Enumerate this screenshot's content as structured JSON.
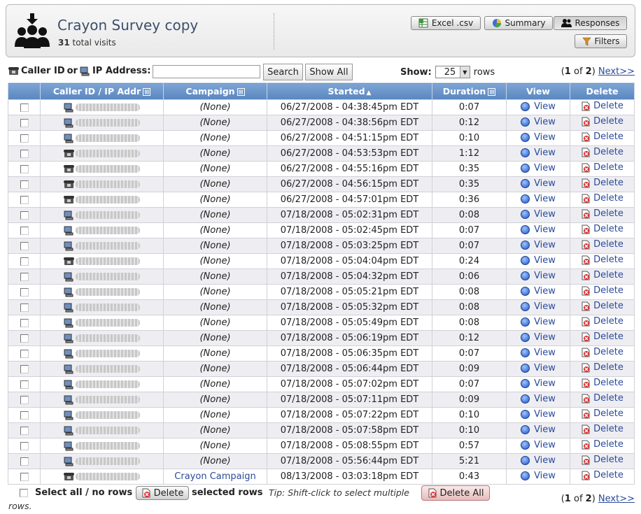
{
  "header": {
    "title": "Crayon Survey copy",
    "visits_count": "31",
    "visits_label": "total visits",
    "buttons": {
      "excel": "Excel .csv",
      "summary": "Summary",
      "responses": "Responses",
      "filters": "Filters"
    }
  },
  "search": {
    "label_caller": "Caller ID",
    "label_or": "or",
    "label_ip": "IP Address:",
    "value": "",
    "search_button": "Search",
    "showall_button": "Show All",
    "show_label": "Show:",
    "rows_value": "25",
    "rows_label": "rows"
  },
  "pager": {
    "current": "1",
    "of": "of",
    "total": "2",
    "next": "Next>>"
  },
  "table": {
    "headers": {
      "caller": "Caller ID / IP Addr",
      "campaign": "Campaign",
      "started": "Started",
      "duration": "Duration",
      "view": "View",
      "delete": "Delete"
    },
    "sort_arrow": "▲",
    "view_label": "View",
    "delete_label": "Delete",
    "rows": [
      {
        "type": "ip",
        "campaign": "(None)",
        "started": "06/27/2008 - 04:38:45pm EDT",
        "duration": "0:07"
      },
      {
        "type": "ip",
        "campaign": "(None)",
        "started": "06/27/2008 - 04:38:56pm EDT",
        "duration": "0:12"
      },
      {
        "type": "ip",
        "campaign": "(None)",
        "started": "06/27/2008 - 04:51:15pm EDT",
        "duration": "0:10"
      },
      {
        "type": "phone",
        "campaign": "(None)",
        "started": "06/27/2008 - 04:53:53pm EDT",
        "duration": "1:12"
      },
      {
        "type": "phone",
        "campaign": "(None)",
        "started": "06/27/2008 - 04:55:16pm EDT",
        "duration": "0:35"
      },
      {
        "type": "phone",
        "campaign": "(None)",
        "started": "06/27/2008 - 04:56:15pm EDT",
        "duration": "0:35"
      },
      {
        "type": "phone",
        "campaign": "(None)",
        "started": "06/27/2008 - 04:57:01pm EDT",
        "duration": "0:36"
      },
      {
        "type": "ip",
        "campaign": "(None)",
        "started": "07/18/2008 - 05:02:31pm EDT",
        "duration": "0:08"
      },
      {
        "type": "ip",
        "campaign": "(None)",
        "started": "07/18/2008 - 05:02:45pm EDT",
        "duration": "0:07"
      },
      {
        "type": "ip",
        "campaign": "(None)",
        "started": "07/18/2008 - 05:03:25pm EDT",
        "duration": "0:07"
      },
      {
        "type": "phone",
        "campaign": "(None)",
        "started": "07/18/2008 - 05:04:04pm EDT",
        "duration": "0:24"
      },
      {
        "type": "ip",
        "campaign": "(None)",
        "started": "07/18/2008 - 05:04:32pm EDT",
        "duration": "0:06"
      },
      {
        "type": "ip",
        "campaign": "(None)",
        "started": "07/18/2008 - 05:05:21pm EDT",
        "duration": "0:08"
      },
      {
        "type": "ip",
        "campaign": "(None)",
        "started": "07/18/2008 - 05:05:32pm EDT",
        "duration": "0:08"
      },
      {
        "type": "ip",
        "campaign": "(None)",
        "started": "07/18/2008 - 05:05:49pm EDT",
        "duration": "0:08"
      },
      {
        "type": "ip",
        "campaign": "(None)",
        "started": "07/18/2008 - 05:06:19pm EDT",
        "duration": "0:12"
      },
      {
        "type": "ip",
        "campaign": "(None)",
        "started": "07/18/2008 - 05:06:35pm EDT",
        "duration": "0:07"
      },
      {
        "type": "ip",
        "campaign": "(None)",
        "started": "07/18/2008 - 05:06:44pm EDT",
        "duration": "0:09"
      },
      {
        "type": "ip",
        "campaign": "(None)",
        "started": "07/18/2008 - 05:07:02pm EDT",
        "duration": "0:07"
      },
      {
        "type": "ip",
        "campaign": "(None)",
        "started": "07/18/2008 - 05:07:11pm EDT",
        "duration": "0:09"
      },
      {
        "type": "ip",
        "campaign": "(None)",
        "started": "07/18/2008 - 05:07:22pm EDT",
        "duration": "0:10"
      },
      {
        "type": "ip",
        "campaign": "(None)",
        "started": "07/18/2008 - 05:07:58pm EDT",
        "duration": "0:10"
      },
      {
        "type": "ip",
        "campaign": "(None)",
        "started": "07/18/2008 - 05:08:55pm EDT",
        "duration": "0:57"
      },
      {
        "type": "ip",
        "campaign": "(None)",
        "started": "07/18/2008 - 05:56:44pm EDT",
        "duration": "5:21"
      },
      {
        "type": "phone",
        "campaign": "Crayon Campaign",
        "campaign_link": true,
        "started": "08/13/2008 - 03:03:18pm EDT",
        "duration": "0:43"
      }
    ]
  },
  "footer": {
    "select_all": "Select all / no rows",
    "delete_button": "Delete",
    "selected_rows": "selected rows",
    "tip_line1": "Tip: Shift-click to select multiple",
    "tip_line2": "rows.",
    "delete_all_button": "Delete All"
  }
}
